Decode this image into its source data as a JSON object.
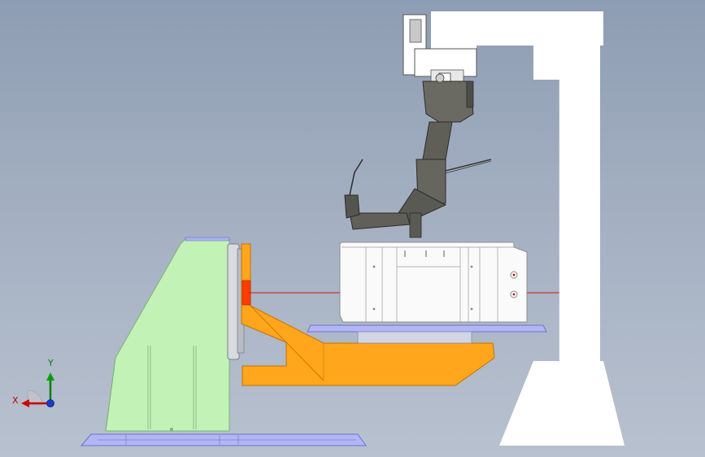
{
  "viewport": {
    "colors": {
      "background_top": "#8e9db3",
      "background_bottom": "#b8c1cf",
      "positioner_frame": "#c2f2b6",
      "faceplate_bracket": "#ffa61c",
      "base_plate": "#b3b6f5",
      "robot_body": "#ffffff",
      "robot_arm": "#6a6a62",
      "axis_line": "#d21010"
    }
  },
  "triad": {
    "x_label": "X",
    "y_label": "Y",
    "x_color": "#c00000",
    "y_color": "#008000",
    "z_color": "#1a3bcc",
    "icon": "coordinate-triad-icon"
  }
}
